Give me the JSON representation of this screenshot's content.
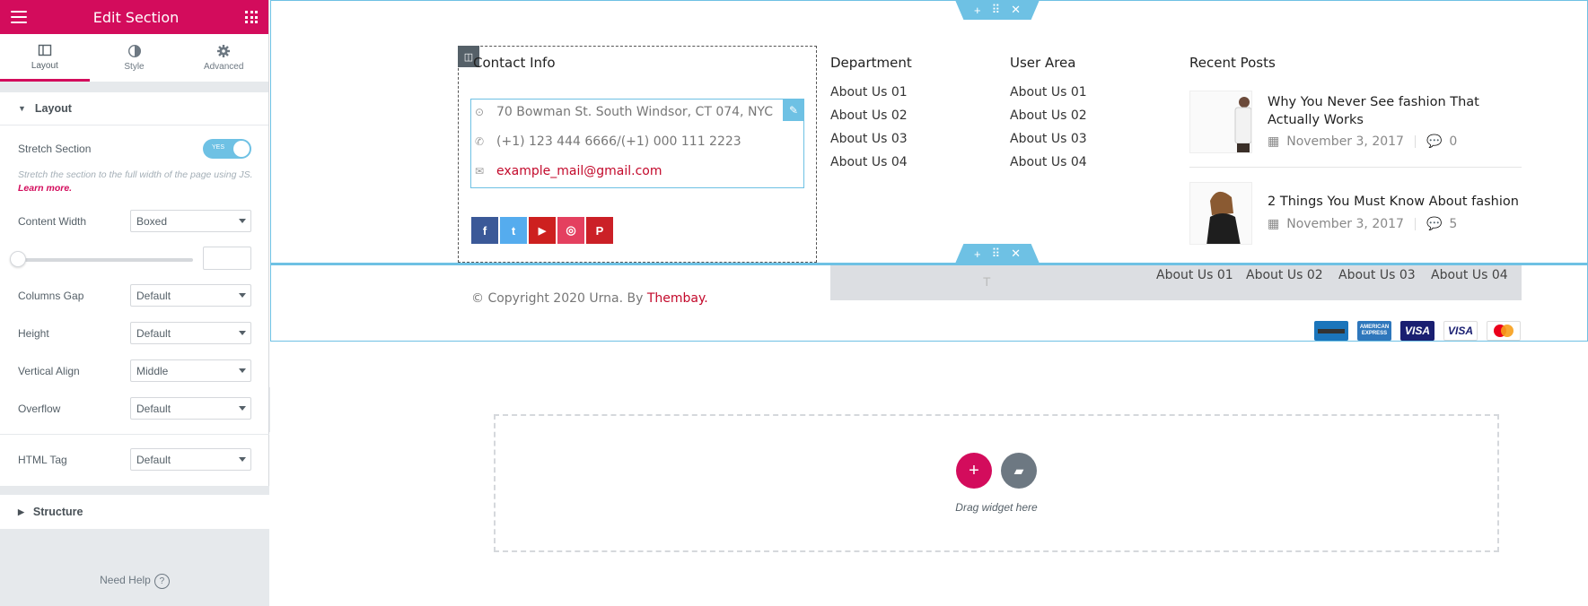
{
  "panel": {
    "title": "Edit Section",
    "tabs": [
      {
        "label": "Layout",
        "icon": "layout-icon"
      },
      {
        "label": "Style",
        "icon": "style-icon"
      },
      {
        "label": "Advanced",
        "icon": "gear-icon"
      }
    ],
    "layout_section": "Layout",
    "stretch_label": "Stretch Section",
    "stretch_toggle": "YES",
    "stretch_help": "Stretch the section to the full width of the page using JS.",
    "learn_more": "Learn more.",
    "content_width_label": "Content Width",
    "content_width_value": "Boxed",
    "columns_gap_label": "Columns Gap",
    "columns_gap_value": "Default",
    "height_label": "Height",
    "height_value": "Default",
    "vertical_align_label": "Vertical Align",
    "vertical_align_value": "Middle",
    "overflow_label": "Overflow",
    "overflow_value": "Default",
    "html_tag_label": "HTML Tag",
    "html_tag_value": "Default",
    "structure_section": "Structure",
    "need_help": "Need Help"
  },
  "footer": {
    "contact": {
      "heading": "Contact Info",
      "address": "70 Bowman St. South Windsor, CT 074, NYC",
      "phone": "(+1) 123 444 6666/(+1) 000 111 2223",
      "email": "example_mail@gmail.com",
      "social": [
        {
          "name": "facebook",
          "glyph": "f",
          "color": "#3b5998"
        },
        {
          "name": "twitter",
          "glyph": "t",
          "color": "#55acee"
        },
        {
          "name": "youtube",
          "glyph": "▶",
          "color": "#cd201f"
        },
        {
          "name": "instagram",
          "glyph": "◎",
          "color": "#e4405f"
        },
        {
          "name": "pinterest",
          "glyph": "P",
          "color": "#cb2027"
        }
      ]
    },
    "department": {
      "heading": "Department",
      "links": [
        "About Us 01",
        "About Us 02",
        "About Us 03",
        "About Us 04"
      ]
    },
    "user_area": {
      "heading": "User Area",
      "links": [
        "About Us 01",
        "About Us 02",
        "About Us 03",
        "About Us 04"
      ]
    },
    "recent_posts": {
      "heading": "Recent Posts",
      "posts": [
        {
          "title_line1": "Why You Never See fashion That",
          "title_line2": "Actually Works",
          "date": "November 3, 2017",
          "comments": "0"
        },
        {
          "title_line1": "2 Things You Must Know About fashion",
          "title_line2": "",
          "date": "November 3, 2017",
          "comments": "5"
        }
      ]
    },
    "copyright_text": "© Copyright 2020 Urna. By ",
    "copyright_link": "Thembay.",
    "bottom_links": [
      "About Us 01",
      "About Us 02",
      "About Us 03",
      "About Us 04"
    ],
    "payments": [
      {
        "name": "generic-card",
        "label": "",
        "color": "#1b75bb"
      },
      {
        "name": "american-express",
        "label": "AMERICAN EXPRESS",
        "color": "#2e77bc"
      },
      {
        "name": "visa-dark",
        "label": "VISA",
        "color": "#1a1f71"
      },
      {
        "name": "visa-light",
        "label": "VISA",
        "color": "#ffffff"
      },
      {
        "name": "mastercard",
        "label": "MasterCard",
        "color": "#ffffff"
      }
    ]
  },
  "drop_zone": {
    "text": "Drag widget here"
  },
  "colors": {
    "brand": "#d30c5c",
    "editor_blue": "#6ec1e4",
    "link_red": "#c3092b"
  }
}
